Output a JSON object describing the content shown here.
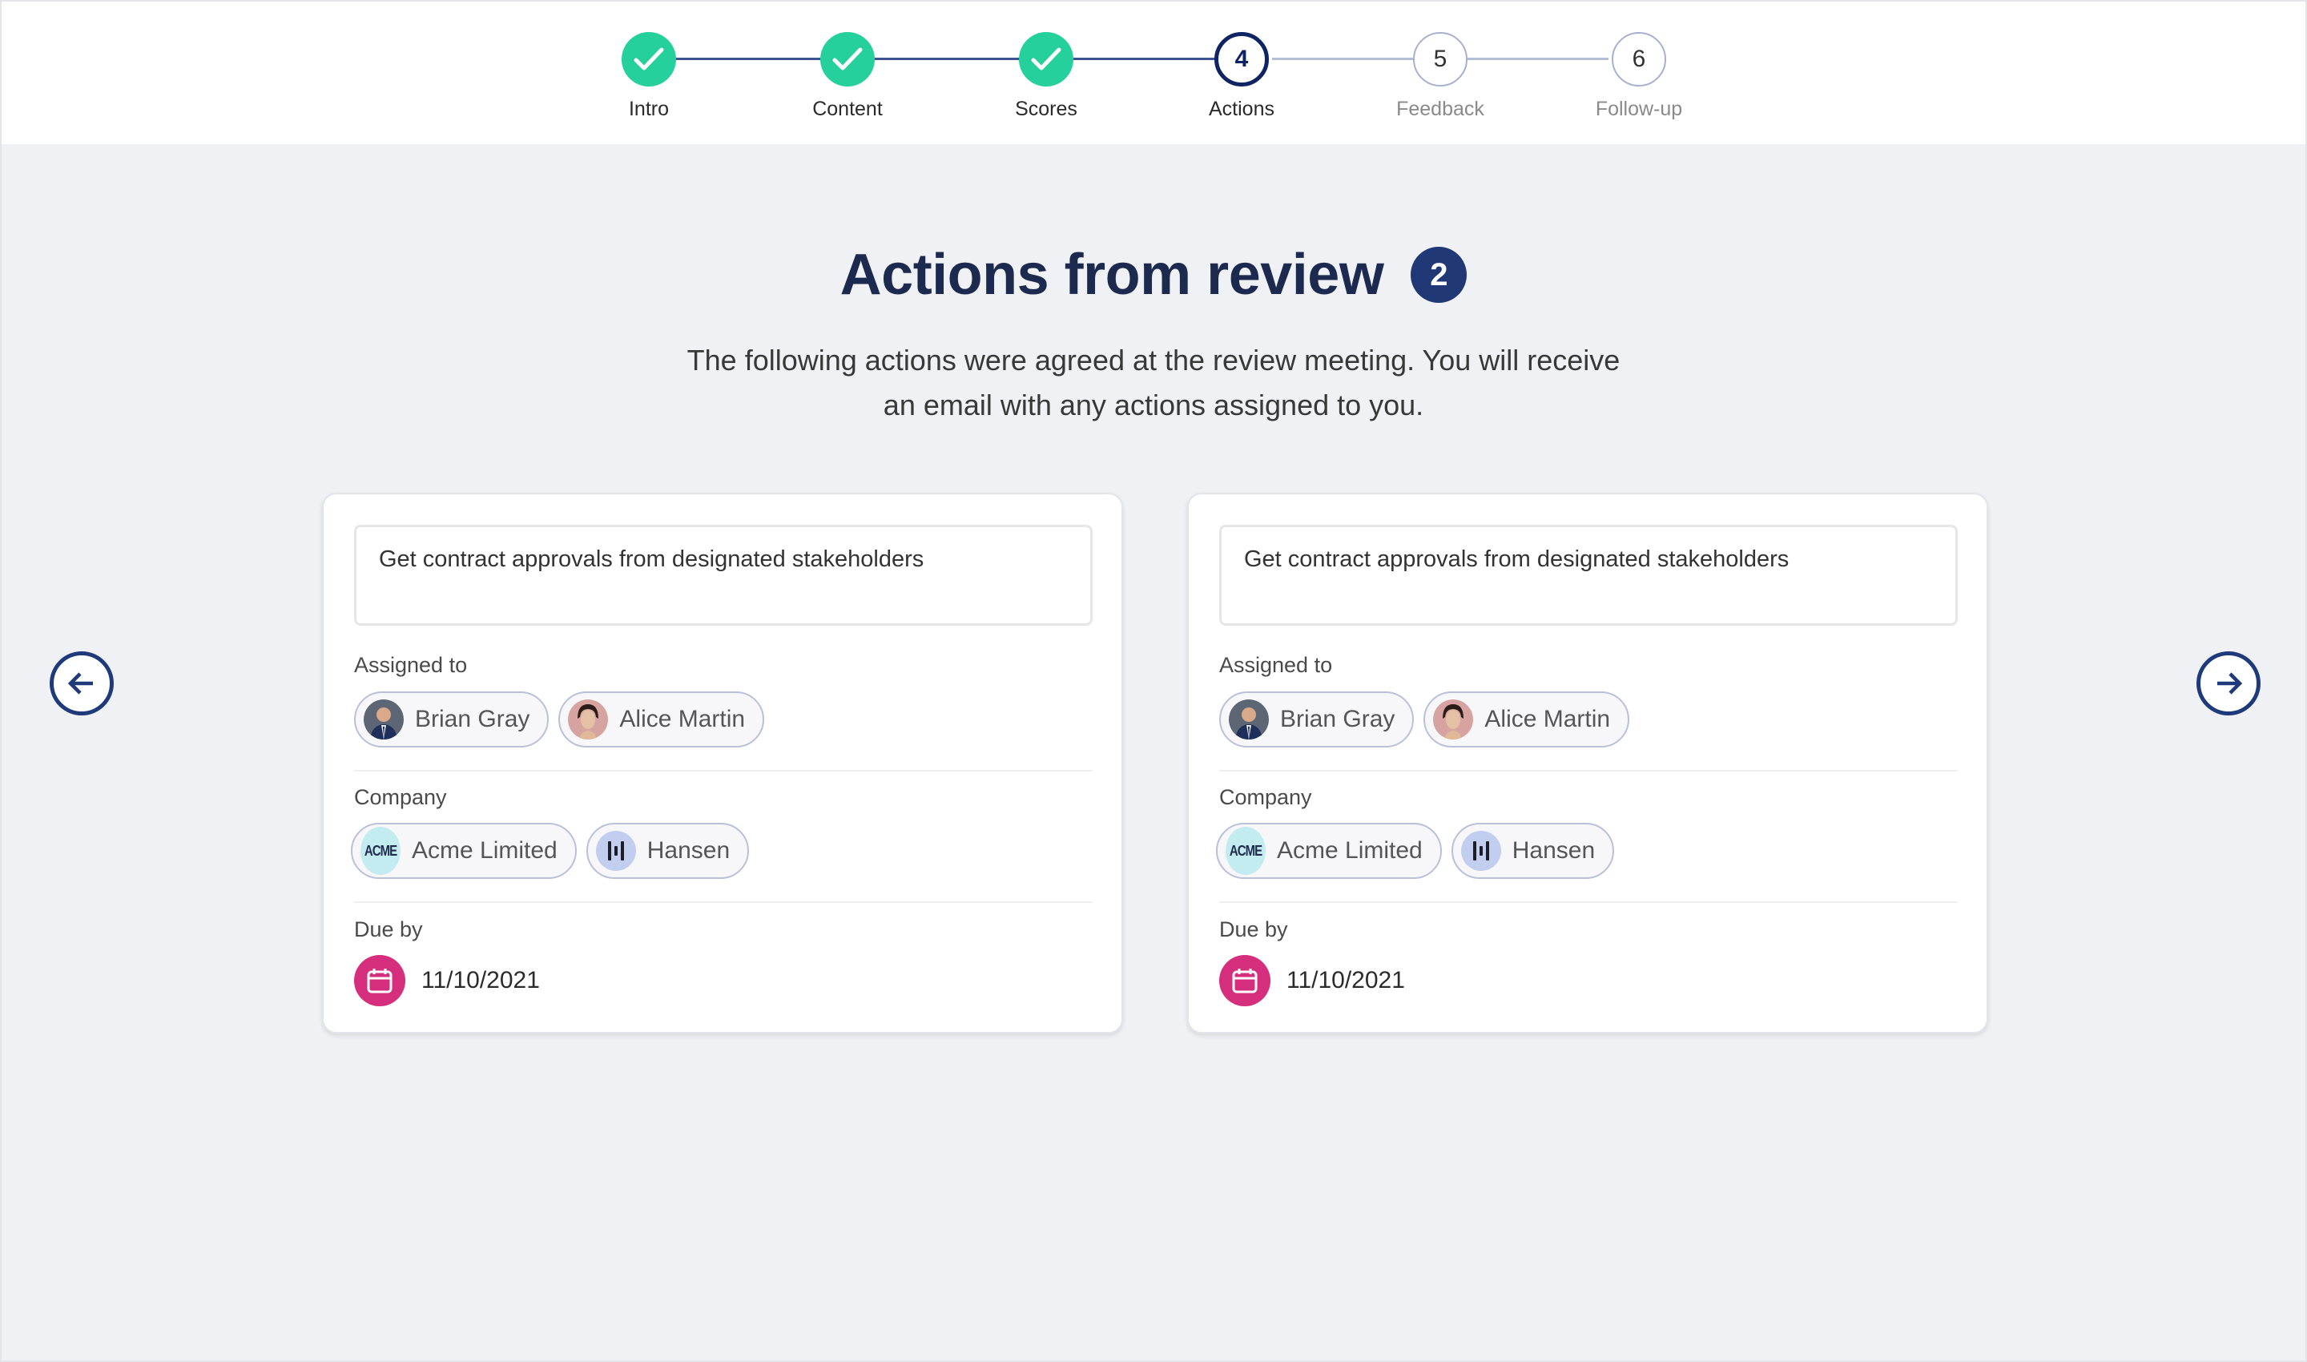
{
  "stepper": {
    "steps": [
      {
        "number": "1",
        "label": "Intro",
        "state": "done"
      },
      {
        "number": "2",
        "label": "Content",
        "state": "done"
      },
      {
        "number": "3",
        "label": "Scores",
        "state": "done"
      },
      {
        "number": "4",
        "label": "Actions",
        "state": "current"
      },
      {
        "number": "5",
        "label": "Feedback",
        "state": "todo"
      },
      {
        "number": "6",
        "label": "Follow-up",
        "state": "todo"
      }
    ]
  },
  "header": {
    "title": "Actions from review",
    "count": "2",
    "subtitle_line1": "The following actions were agreed at the review meeting. You will receive",
    "subtitle_line2": "an email with any actions assigned to you."
  },
  "nav": {
    "prev_icon": "arrow-left-icon",
    "next_icon": "arrow-right-icon"
  },
  "labels": {
    "assigned_to": "Assigned to",
    "company": "Company",
    "due_by": "Due by"
  },
  "actions": [
    {
      "description": "Get contract approvals from designated stakeholders",
      "assignees": [
        {
          "name": "Brian Gray",
          "avatar": "avatar-man-suit"
        },
        {
          "name": "Alice Martin",
          "avatar": "avatar-woman"
        }
      ],
      "companies": [
        {
          "name": "Acme Limited",
          "logo_text": "ACME"
        },
        {
          "name": "Hansen",
          "logo": "bars-logo"
        }
      ],
      "due_date": "11/10/2021"
    },
    {
      "description": "Get contract approvals from designated stakeholders",
      "assignees": [
        {
          "name": "Brian Gray",
          "avatar": "avatar-man-suit"
        },
        {
          "name": "Alice Martin",
          "avatar": "avatar-woman"
        }
      ],
      "companies": [
        {
          "name": "Acme Limited",
          "logo_text": "ACME"
        },
        {
          "name": "Hansen",
          "logo": "bars-logo"
        }
      ],
      "due_date": "11/10/2021"
    }
  ],
  "colors": {
    "done": "#25d09c",
    "current": "#0f2463",
    "accent": "#213876",
    "calendar": "#d42e7c",
    "background": "#f0f1f5"
  }
}
